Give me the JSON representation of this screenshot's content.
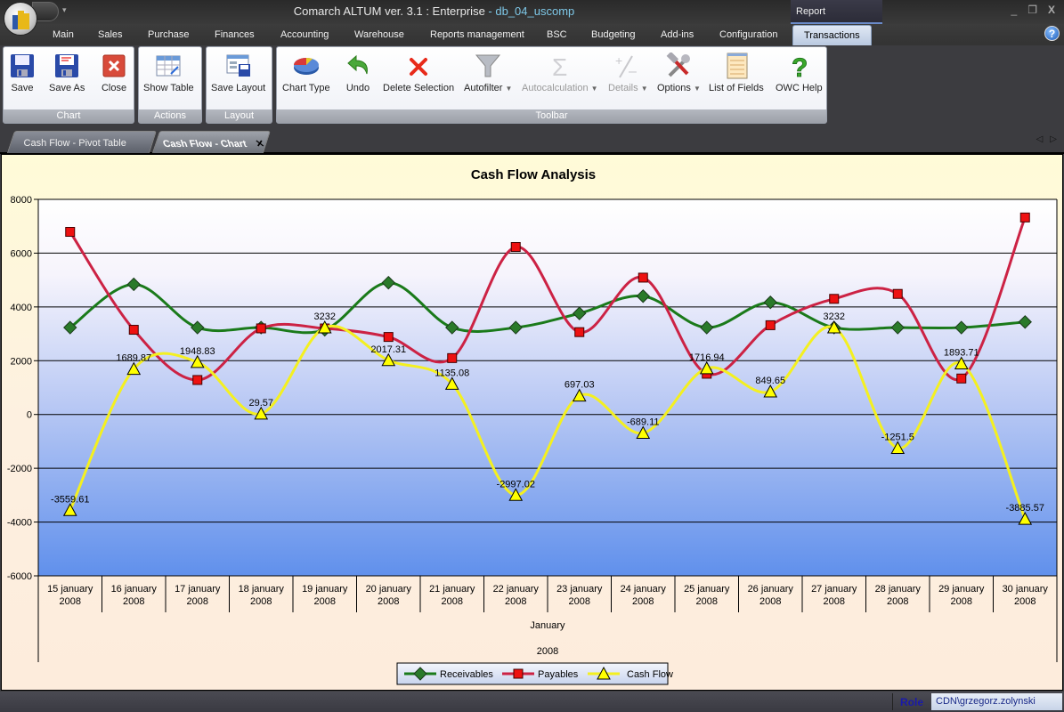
{
  "titlebar": {
    "app_title": "Comarch ALTUM ver. 3.1 : Enterprise",
    "separator": " - ",
    "database": "db_04_uscomp",
    "context_tab": "Report",
    "controls": {
      "minimize": "_",
      "restore": "❐",
      "close": "X"
    }
  },
  "menu": {
    "items": [
      "Main",
      "Sales",
      "Purchase",
      "Finances",
      "Accounting",
      "Warehouse",
      "Reports management",
      "BSC",
      "Budgeting",
      "Add-ins",
      "Configuration",
      "Transactions"
    ],
    "active": "Transactions",
    "help": "?"
  },
  "ribbon": {
    "groups": [
      {
        "label": "Chart",
        "buttons": [
          {
            "label": "Save",
            "icon": "floppy-disk-icon"
          },
          {
            "label": "Save As",
            "icon": "floppy-disk-edit-icon"
          },
          {
            "label": "Close",
            "icon": "close-red-icon"
          }
        ]
      },
      {
        "label": "Actions",
        "buttons": [
          {
            "label": "Show Table",
            "icon": "table-swap-icon"
          }
        ]
      },
      {
        "label": "Layout",
        "buttons": [
          {
            "label": "Save Layout",
            "icon": "save-layout-icon"
          }
        ]
      },
      {
        "label": "Toolbar",
        "buttons": [
          {
            "label": "Chart Type",
            "icon": "pie-chart-icon"
          },
          {
            "label": "Undo",
            "icon": "undo-arrow-icon"
          },
          {
            "label": "Delete Selection",
            "icon": "delete-x-icon"
          },
          {
            "label": "Autofilter",
            "icon": "funnel-icon",
            "dropdown": true
          },
          {
            "label": "Autocalculation",
            "icon": "sigma-icon",
            "dropdown": true,
            "disabled": true
          },
          {
            "label": "Details",
            "icon": "plus-minus-icon",
            "dropdown": true,
            "disabled": true
          },
          {
            "label": "Options",
            "icon": "tools-icon",
            "dropdown": true
          },
          {
            "label": "List of Fields",
            "icon": "field-list-icon"
          },
          {
            "label": "OWC Help",
            "icon": "question-mark-icon"
          }
        ]
      }
    ]
  },
  "doc_tabs": {
    "tabs": [
      {
        "label": "Cash Flow - Pivot Table",
        "active": false
      },
      {
        "label": "Cash Flow - Chart",
        "active": true
      }
    ],
    "close": "✕",
    "nav_prev": "◁",
    "nav_next": "▷"
  },
  "chart_data": {
    "type": "line",
    "title": "Cash Flow Analysis",
    "xlabel": "January",
    "xlabel2": "2008",
    "ylabel": "",
    "ylim": [
      -6000,
      8000
    ],
    "yticks": [
      -6000,
      -4000,
      -2000,
      0,
      2000,
      4000,
      6000,
      8000
    ],
    "grid": true,
    "smooth": true,
    "legend_position": "bottom",
    "categories": [
      "15 january 2008",
      "16 january 2008",
      "17 january 2008",
      "18 january 2008",
      "19 january 2008",
      "20 january 2008",
      "21 january 2008",
      "22 january 2008",
      "23 january 2008",
      "24 january 2008",
      "25 january 2008",
      "26 january 2008",
      "27 january 2008",
      "28 january 2008",
      "29 january 2008",
      "30 january 2008"
    ],
    "category_lines": [
      [
        "15 january",
        "2008"
      ],
      [
        "16 january",
        "2008"
      ],
      [
        "17 january",
        "2008"
      ],
      [
        "18 january",
        "2008"
      ],
      [
        "19 january",
        "2008"
      ],
      [
        "20 january",
        "2008"
      ],
      [
        "21 january",
        "2008"
      ],
      [
        "22 january",
        "2008"
      ],
      [
        "23 january",
        "2008"
      ],
      [
        "24 january",
        "2008"
      ],
      [
        "25 january",
        "2008"
      ],
      [
        "26 january",
        "2008"
      ],
      [
        "27 january",
        "2008"
      ],
      [
        "28 january",
        "2008"
      ],
      [
        "29 january",
        "2008"
      ],
      [
        "30 january",
        "2008"
      ]
    ],
    "series": [
      {
        "name": "Receivables",
        "color": "#1a7a1a",
        "marker": "diamond",
        "marker_color": "#2a7a2a",
        "values": [
          3232,
          4840,
          3232,
          3232,
          3150,
          4900,
          3232,
          3232,
          3760,
          4400,
          3232,
          4170,
          3232,
          3232,
          3232,
          3440
        ]
      },
      {
        "name": "Payables",
        "color": "#cc2244",
        "marker": "square",
        "marker_color": "#ee1111",
        "values": [
          6792,
          3150,
          1283,
          3202,
          3200,
          2883,
          2097,
          6229,
          3063,
          5089,
          1515,
          3320,
          4300,
          4484,
          1338,
          7326
        ]
      },
      {
        "name": "Cash Flow",
        "color": "#f4f020",
        "marker": "triangle",
        "marker_color": "#ffff00",
        "values": [
          -3559.61,
          1689.87,
          1948.83,
          29.57,
          3232,
          2017.31,
          1135.08,
          -2997.02,
          697.03,
          -689.11,
          1716.94,
          849.65,
          3232,
          -1251.5,
          1893.71,
          -3885.57
        ],
        "labels": [
          "-3559.61",
          "1689.87",
          "1948.83",
          "29.57",
          "3232",
          "2017.31",
          "1135.08",
          "-2997.02",
          "697.03",
          "-689.11",
          "1716.94",
          "849.65",
          "3232",
          "-1251.5",
          "1893.71",
          "-3885.57"
        ]
      }
    ]
  },
  "status": {
    "role_label": "Role",
    "user": "CDN\\grzegorz.zolynski"
  }
}
